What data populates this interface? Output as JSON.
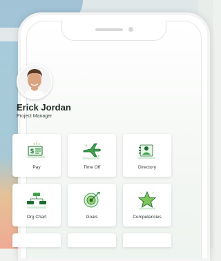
{
  "profile": {
    "name": "Erick Jordan",
    "title": "Project Manager"
  },
  "apps": [
    {
      "label": "Pay",
      "icon": "pay-icon"
    },
    {
      "label": "Time Off",
      "icon": "airplane-icon"
    },
    {
      "label": "Directory",
      "icon": "directory-icon"
    },
    {
      "label": "Org Chart",
      "icon": "org-chart-icon"
    },
    {
      "label": "Goals",
      "icon": "target-icon"
    },
    {
      "label": "Competencies",
      "icon": "star-icon"
    }
  ],
  "colors": {
    "accent_green": "#3fa34d",
    "dark_green": "#1e6b2f"
  }
}
